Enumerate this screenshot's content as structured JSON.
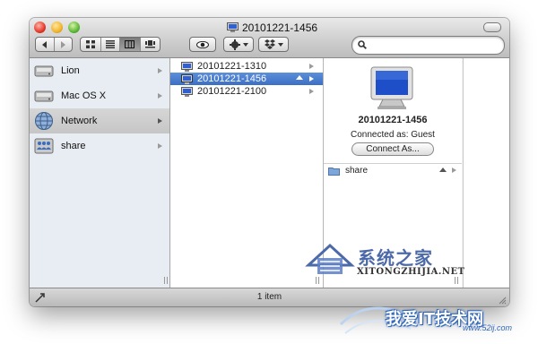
{
  "window": {
    "title": "20101221-1456"
  },
  "toolbar": {
    "back_icon": "back-arrow-icon",
    "forward_icon": "forward-arrow-icon",
    "view_modes": [
      "icon-view",
      "list-view",
      "column-view",
      "cover-flow-view"
    ],
    "active_view": "column-view",
    "quick_look_icon": "eye-icon",
    "action_icon": "gear-icon",
    "share_icon": "dropbox-icon",
    "search": {
      "value": "",
      "placeholder": ""
    }
  },
  "sidebar": {
    "items": [
      {
        "label": "Lion",
        "icon": "hard-drive-icon"
      },
      {
        "label": "Mac OS X",
        "icon": "hard-drive-icon"
      },
      {
        "label": "Network",
        "icon": "network-globe-icon",
        "selected": true
      },
      {
        "label": "share",
        "icon": "shared-volume-icon"
      }
    ]
  },
  "column": {
    "items": [
      {
        "label": "20101221-1310",
        "icon": "monitor-icon"
      },
      {
        "label": "20101221-1456",
        "icon": "monitor-icon",
        "selected": true
      },
      {
        "label": "20101221-2100",
        "icon": "monitor-icon"
      }
    ]
  },
  "preview": {
    "name": "20101221-1456",
    "connected_as": "Connected as: Guest",
    "connect_button": "Connect As...",
    "shares": [
      {
        "label": "share",
        "icon": "folder-icon"
      }
    ]
  },
  "status": {
    "text": "1 item"
  },
  "watermarks": {
    "primary_cn": "系统之家",
    "primary_en": "XITONGZHIJIA.NET",
    "secondary_cn": "我爱IT技术网",
    "secondary_url": "www.52ij.com"
  },
  "colors": {
    "selection": "#3c6fc4",
    "sidebar_bg": "#e8edf3",
    "watermark_blue": "#2f66b8"
  }
}
